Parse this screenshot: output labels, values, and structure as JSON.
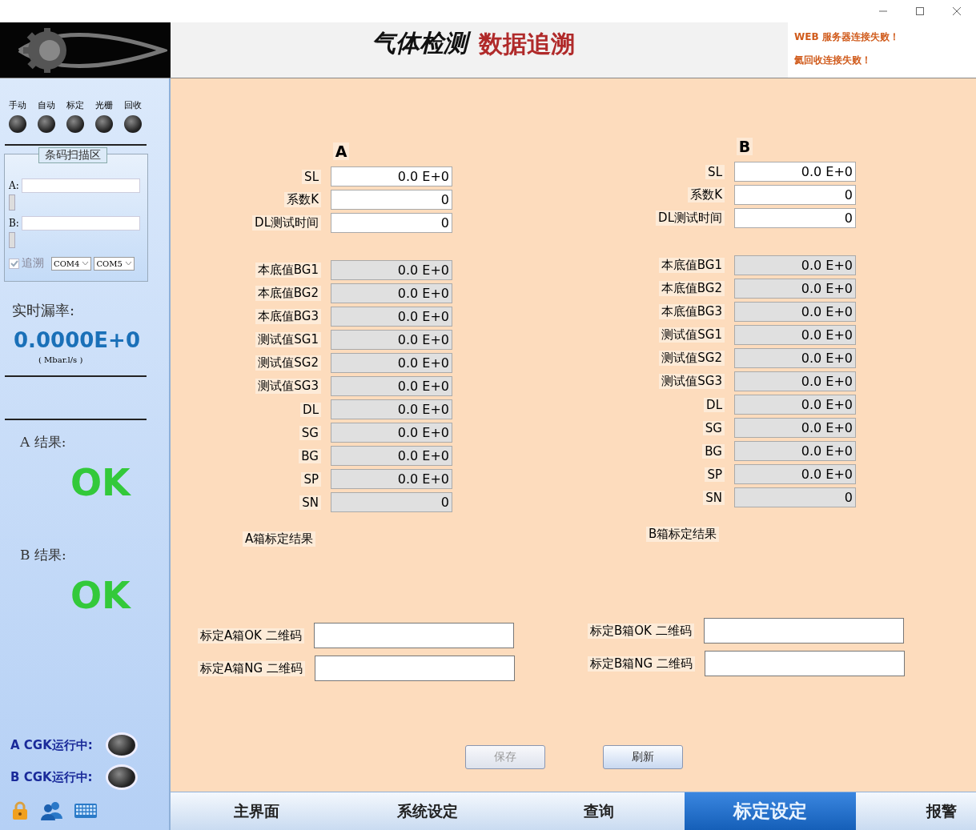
{
  "header": {
    "title": "气体检测",
    "subtitle": "数据追溯",
    "alerts": [
      "WEB 服务器连接失败！",
      "氦回收连接失败！"
    ]
  },
  "sidebar": {
    "indicators": [
      {
        "label": "手动",
        "on": false
      },
      {
        "label": "自动",
        "on": false
      },
      {
        "label": "标定",
        "on": false
      },
      {
        "label": "光栅",
        "on": false
      },
      {
        "label": "回收",
        "on": false
      }
    ],
    "scan": {
      "title": "条码扫描区",
      "fields": [
        {
          "label": "A:"
        },
        {
          "label": "B:"
        }
      ],
      "trace": {
        "label": "追溯",
        "checked": true
      },
      "ports": [
        "COM4",
        "COM5"
      ]
    },
    "leak_rate": {
      "label": "实时漏率:",
      "value": "0.0000E+0",
      "unit": "( Mbar.l/s )"
    },
    "results": [
      {
        "label": "A  结果:",
        "value": "OK",
        "passed": true
      },
      {
        "label": "B  结果:",
        "value": "OK",
        "passed": true
      }
    ],
    "cgk": [
      {
        "label": "A CGK运行中:",
        "on": false
      },
      {
        "label": "B CGK运行中:",
        "on": false
      }
    ]
  },
  "boxes": [
    {
      "heading": "A",
      "params": [
        {
          "label": "SL",
          "value": "0.0 E+0",
          "readonly": false
        },
        {
          "label": "系数K",
          "value": "0",
          "readonly": false
        },
        {
          "label": "DL测试时间",
          "value": "0",
          "readonly": false
        },
        {
          "label": "本底值BG1",
          "value": "0.0 E+0",
          "readonly": true
        },
        {
          "label": "本底值BG2",
          "value": "0.0 E+0",
          "readonly": true
        },
        {
          "label": "本底值BG3",
          "value": "0.0 E+0",
          "readonly": true
        },
        {
          "label": "测试值SG1",
          "value": "0.0 E+0",
          "readonly": true
        },
        {
          "label": "测试值SG2",
          "value": "0.0 E+0",
          "readonly": true
        },
        {
          "label": "测试值SG3",
          "value": "0.0 E+0",
          "readonly": true
        },
        {
          "label": "DL",
          "value": "0.0 E+0",
          "readonly": true
        },
        {
          "label": "SG",
          "value": "0.0 E+0",
          "readonly": true
        },
        {
          "label": "BG",
          "value": "0.0 E+0",
          "readonly": true
        },
        {
          "label": "SP",
          "value": "0.0 E+0",
          "readonly": true
        },
        {
          "label": "SN",
          "value": "0",
          "readonly": true
        }
      ],
      "result_label": "A箱标定结果",
      "qr": [
        {
          "label": "标定A箱OK 二维码"
        },
        {
          "label": "标定A箱NG 二维码"
        }
      ]
    },
    {
      "heading": "B",
      "params": [
        {
          "label": "SL",
          "value": "0.0 E+0",
          "readonly": false
        },
        {
          "label": "系数K",
          "value": "0",
          "readonly": false
        },
        {
          "label": "DL测试时间",
          "value": "0",
          "readonly": false
        },
        {
          "label": "本底值BG1",
          "value": "0.0 E+0",
          "readonly": true
        },
        {
          "label": "本底值BG2",
          "value": "0.0 E+0",
          "readonly": true
        },
        {
          "label": "本底值BG3",
          "value": "0.0 E+0",
          "readonly": true
        },
        {
          "label": "测试值SG1",
          "value": "0.0 E+0",
          "readonly": true
        },
        {
          "label": "测试值SG2",
          "value": "0.0 E+0",
          "readonly": true
        },
        {
          "label": "测试值SG3",
          "value": "0.0 E+0",
          "readonly": true
        },
        {
          "label": "DL",
          "value": "0.0 E+0",
          "readonly": true
        },
        {
          "label": "SG",
          "value": "0.0 E+0",
          "readonly": true
        },
        {
          "label": "BG",
          "value": "0.0 E+0",
          "readonly": true
        },
        {
          "label": "SP",
          "value": "0.0 E+0",
          "readonly": true
        },
        {
          "label": "SN",
          "value": "0",
          "readonly": true
        }
      ],
      "result_label": "B箱标定结果",
      "qr": [
        {
          "label": "标定B箱OK 二维码"
        },
        {
          "label": "标定B箱NG 二维码"
        }
      ]
    }
  ],
  "buttons": [
    {
      "label": "保存",
      "disabled": true
    },
    {
      "label": "刷新",
      "disabled": false
    }
  ],
  "tabs": [
    {
      "label": "主界面",
      "selected": false
    },
    {
      "label": "系统设定",
      "selected": false
    },
    {
      "label": "查询",
      "selected": false
    },
    {
      "label": "标定设定",
      "selected": true
    },
    {
      "label": "报警",
      "selected": false
    }
  ]
}
